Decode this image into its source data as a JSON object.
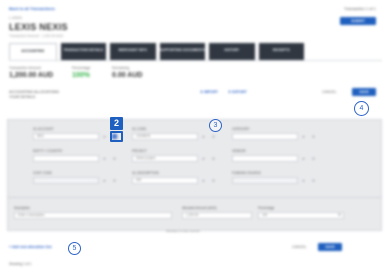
{
  "nav": {
    "back_label": "Back to all Transactions",
    "top_right": "Transaction 1 of 1"
  },
  "header": {
    "code": "L-00001",
    "title": "LEXIS NEXIS",
    "subtitle": "Transaction Amount · 1,000.00 AUD",
    "submit_label": "SUBMIT"
  },
  "tabs": [
    {
      "label": "ACCOUNTING"
    },
    {
      "label": "TRANSACTION DETAILS"
    },
    {
      "label": "MERCHANT INFO"
    },
    {
      "label": "SUPPORTING DOCUMENTS"
    },
    {
      "label": "HISTORY"
    },
    {
      "label": "RECEIPTS"
    }
  ],
  "summary": {
    "transaction_label": "Transaction Amount",
    "transaction_value": "1,200.00 AUD",
    "percentage_label": "Percentage",
    "percentage_value": "100%",
    "remaining_label": "Remaining",
    "remaining_value": "0.00 AUD"
  },
  "accounting": {
    "line1": "ACCOUNTING ALLOCATIONS",
    "line2": "YOUR DETAILS",
    "import_label": "IMPORT",
    "export_label": "EXPORT",
    "cancel_label": "CANCEL",
    "save_label": "SAVE"
  },
  "form": {
    "row1": [
      {
        "label": "GL ACCOUNT",
        "value": "6521"
      },
      {
        "label": "GL CODE",
        "value": "12345678"
      },
      {
        "label": "CATEGORY",
        "value": ""
      }
    ],
    "row2": [
      {
        "label": "ENTITY / COUNTRY",
        "value": ""
      },
      {
        "label": "PROJECT",
        "value": "Select project"
      },
      {
        "label": "VENDOR",
        "value": ""
      }
    ],
    "row3": [
      {
        "label": "COST CODE",
        "value": ""
      },
      {
        "label": "GL DESCRIPTION",
        "value": "000"
      },
      {
        "label": "FUNDING SOURCE",
        "value": ""
      }
    ],
    "description_label": "Description",
    "description_placeholder": "Enter a description",
    "amount_label": "Allocated Amount (AUD)",
    "amount_value": "1,200.00",
    "percentage_label": "Percentage",
    "percentage_value": "100",
    "percent_suffix": "%",
    "hint": "Allocation is fully covered"
  },
  "annotations": {
    "badge": "2",
    "circle_a": "3",
    "circle_b": "4",
    "circle_c": "5"
  },
  "footer": {
    "add_label": "+ Add new allocation line",
    "cancel_label": "CANCEL",
    "save_label": "SAVE",
    "showing": "Showing 1 of 1"
  }
}
